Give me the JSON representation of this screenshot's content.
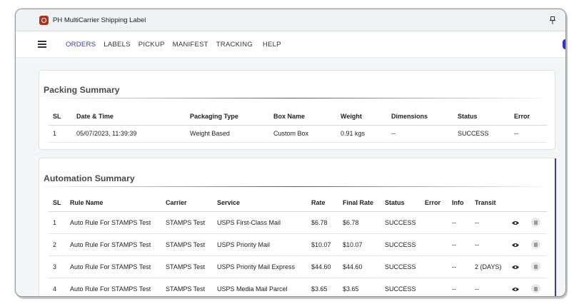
{
  "app": {
    "title": "PH MultiCarrier Shipping Label",
    "icon": "app-logo-icon"
  },
  "nav": {
    "items": [
      {
        "label": "ORDERS",
        "active": true
      },
      {
        "label": "LABELS"
      },
      {
        "label": "PICKUP"
      },
      {
        "label": "MANIFEST"
      },
      {
        "label": "TRACKING"
      },
      {
        "label": "HELP"
      }
    ],
    "accent": "#3a3aa8"
  },
  "packing_summary": {
    "title": "Packing Summary",
    "columns": [
      "SL",
      "Date & Time",
      "Packaging Type",
      "Box Name",
      "Weight",
      "Dimensions",
      "Status",
      "Error"
    ],
    "rows": [
      [
        "1",
        "05/07/2023, 11:39:39",
        "Weight Based",
        "Custom Box",
        "0.91 kgs",
        "--",
        "SUCCESS",
        "--"
      ]
    ]
  },
  "automation_summary": {
    "title": "Automation Summary",
    "columns": [
      "SL",
      "Rule Name",
      "Carrier",
      "Service",
      "Rate",
      "Final Rate",
      "Status",
      "Error",
      "Info",
      "Transit"
    ],
    "rows": [
      [
        "1",
        "Auto Rule For STAMPS Test",
        "STAMPS Test",
        "USPS First-Class Mail",
        "$6.78",
        "$6.78",
        "SUCCESS",
        "",
        "--",
        "--"
      ],
      [
        "2",
        "Auto Rule For STAMPS Test",
        "STAMPS Test",
        "USPS Priority Mail",
        "$10.07",
        "$10.07",
        "SUCCESS",
        "",
        "--",
        "--"
      ],
      [
        "3",
        "Auto Rule For STAMPS Test",
        "STAMPS Test",
        "USPS Priority Mail Express",
        "$44.60",
        "$44.60",
        "SUCCESS",
        "",
        "--",
        "2 (DAYS)"
      ],
      [
        "4",
        "Auto Rule For STAMPS Test",
        "STAMPS Test",
        "USPS Media Mail Parcel",
        "$3.65",
        "$3.65",
        "SUCCESS",
        "",
        "--",
        "--"
      ]
    ],
    "row_actions": [
      "eye-icon",
      "document-icon"
    ]
  }
}
